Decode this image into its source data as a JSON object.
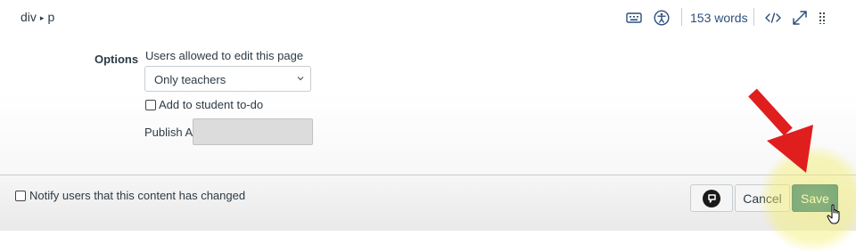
{
  "statusbar": {
    "path_element_1": "div",
    "path_separator": "▸",
    "path_element_2": "p",
    "word_count": "153 words",
    "icons": [
      "keyboard-icon",
      "accessibility-icon",
      "html-editor-icon",
      "fullscreen-icon",
      "drag-handle-icon"
    ]
  },
  "options": {
    "section_label": "Options",
    "permission_label": "Users allowed to edit this page",
    "permission_selected": "Only teachers",
    "todo_label": "Add to student to-do",
    "todo_checked": false,
    "publish_at_label": "Publish At",
    "publish_at_value": ""
  },
  "footer": {
    "notify_label": "Notify users that this content has changed",
    "notify_checked": false,
    "cancel_label": "Cancel",
    "save_label": "Save"
  },
  "colors": {
    "accent": "#2b4f7a",
    "save_button": "#0b6a8a",
    "annotation_arrow": "#e01e1e",
    "click_highlight": "#f5ee6e"
  }
}
